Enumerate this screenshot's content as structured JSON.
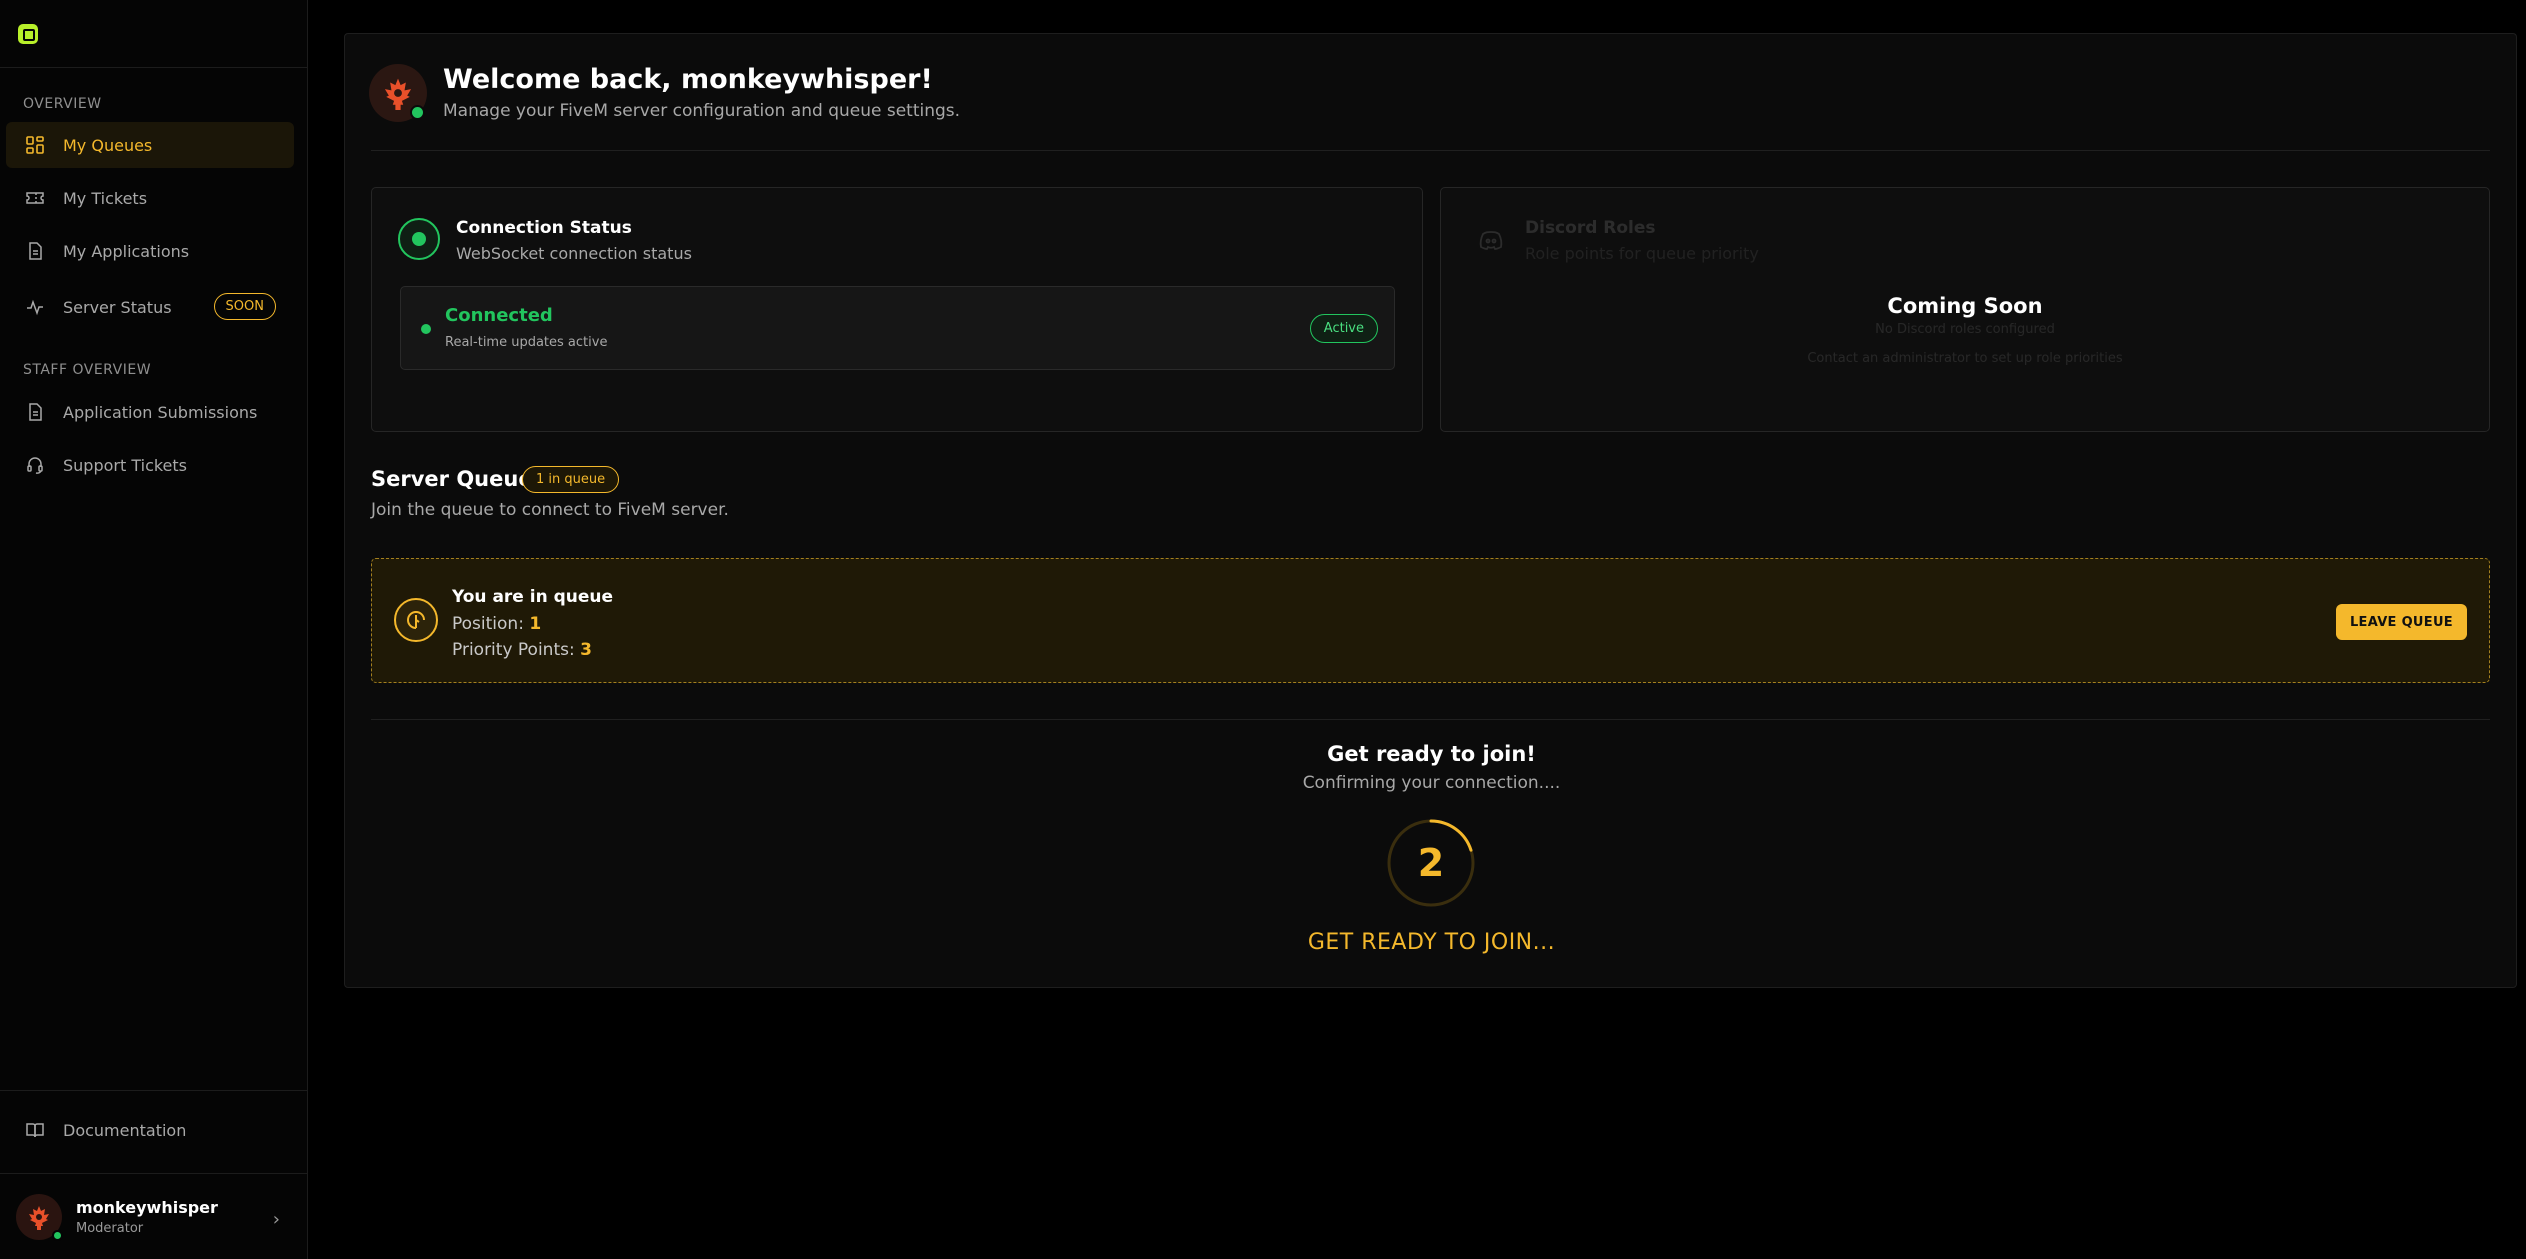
{
  "sidebar": {
    "sections": {
      "overview": "OVERVIEW",
      "staff_overview": "STAFF OVERVIEW"
    },
    "items": [
      {
        "label": "My Queues",
        "icon": "grid-icon"
      },
      {
        "label": "My Tickets",
        "icon": "ticket-icon"
      },
      {
        "label": "My Applications",
        "icon": "document-icon"
      },
      {
        "label": "Server Status",
        "icon": "activity-icon",
        "badge": "SOON"
      },
      {
        "label": "Application Submissions",
        "icon": "document-icon"
      },
      {
        "label": "Support Tickets",
        "icon": "headset-icon"
      }
    ],
    "documentation": "Documentation",
    "user": {
      "name": "monkeywhisper",
      "role": "Moderator"
    }
  },
  "header": {
    "title": "Welcome back, monkeywhisper!",
    "subtitle": "Manage your FiveM server configuration and queue settings."
  },
  "connection": {
    "title": "Connection Status",
    "subtitle": "WebSocket connection status",
    "state": "Connected",
    "detail": "Real-time updates active",
    "badge": "Active"
  },
  "discord": {
    "title": "Discord Roles",
    "subtitle": "Role points for queue priority",
    "overlay": "Coming Soon",
    "empty_line": "No Discord roles configured",
    "help_line": "Contact an administrator to set up role priorities"
  },
  "queue": {
    "title": "Server Queue",
    "count_badge": "1 in queue",
    "subtitle": "Join the queue to connect to FiveM server.",
    "status": "You are in queue",
    "position_label": "Position:",
    "position_value": "1",
    "points_label": "Priority Points:",
    "points_value": "3",
    "leave_button": "LEAVE QUEUE"
  },
  "ready": {
    "title": "Get ready to join!",
    "subtitle": "Confirming your connection....",
    "countdown": "2",
    "countdown_progress": 0.2,
    "cta": "GET READY TO JOIN..."
  },
  "colors": {
    "accent": "#f4b82c",
    "success": "#22c55e",
    "background": "#000000",
    "panel": "#0b0b0b"
  }
}
